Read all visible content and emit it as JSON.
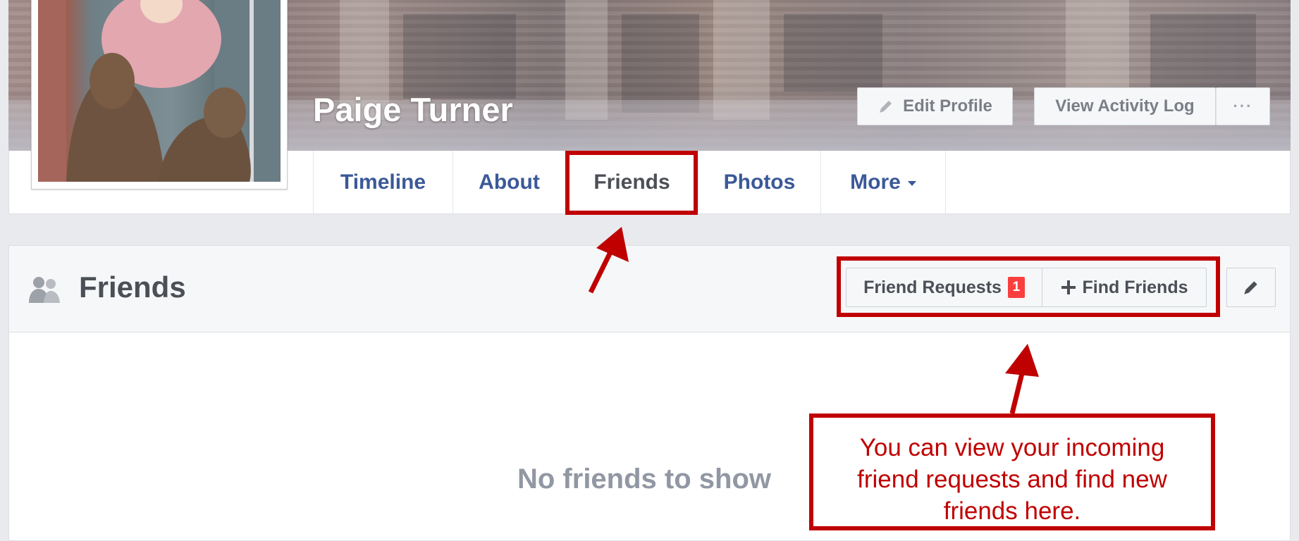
{
  "profile": {
    "name": "Paige Turner",
    "edit_profile_label": "Edit Profile",
    "view_activity_log_label": "View Activity Log",
    "more_options_label": "···"
  },
  "nav": {
    "tabs": [
      {
        "label": "Timeline"
      },
      {
        "label": "About"
      },
      {
        "label": "Friends",
        "selected": true
      },
      {
        "label": "Photos"
      },
      {
        "label": "More"
      }
    ]
  },
  "friends_panel": {
    "title": "Friends",
    "friend_requests_label": "Friend Requests",
    "friend_requests_count": "1",
    "find_friends_label": "Find Friends",
    "empty_message": "No friends to show"
  },
  "annotation": {
    "callout_text": "You can view your incoming friend requests and find new friends here.",
    "color": "#c00000"
  },
  "icons": [
    "pencil-icon",
    "friends-icon",
    "plus-icon",
    "caret-down-icon",
    "more-dots-icon"
  ],
  "colors": {
    "link_blue": "#3b5998",
    "badge_red": "#fa3e3e",
    "annotation_red": "#c00000"
  }
}
